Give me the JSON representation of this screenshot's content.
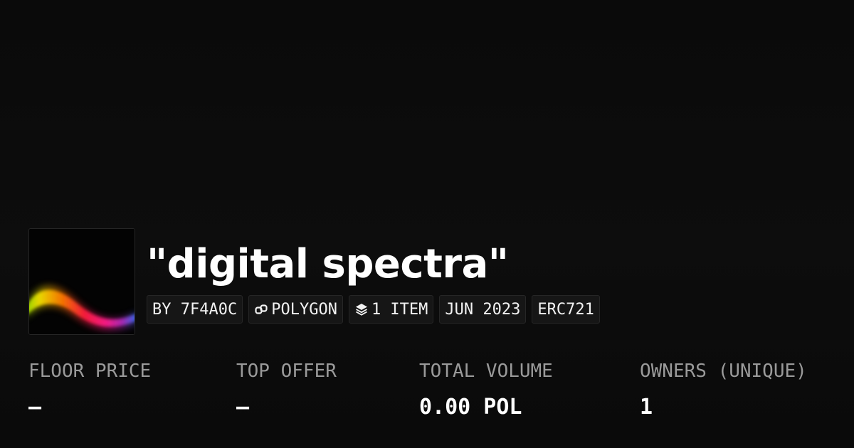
{
  "collection": {
    "title": "\"digital spectra\"",
    "tags": [
      {
        "label": "BY 7F4A0C",
        "icon": ""
      },
      {
        "label": "POLYGON",
        "icon": "chain-link-icon"
      },
      {
        "label": "1 ITEM",
        "icon": "stack-layers-icon"
      },
      {
        "label": "JUN 2023",
        "icon": ""
      },
      {
        "label": "ERC721",
        "icon": ""
      }
    ]
  },
  "stats": [
    {
      "label": "FLOOR PRICE",
      "value": "—"
    },
    {
      "label": "TOP OFFER",
      "value": "—"
    },
    {
      "label": "TOTAL VOLUME",
      "value": "0.00 POL"
    },
    {
      "label": "OWNERS (UNIQUE)",
      "value": "1"
    }
  ],
  "colors": {
    "background": "#0b0b0b",
    "text": "#ffffff",
    "muted": "#9a9a9a",
    "tag_bg": "#161616",
    "tag_border": "#262626"
  }
}
